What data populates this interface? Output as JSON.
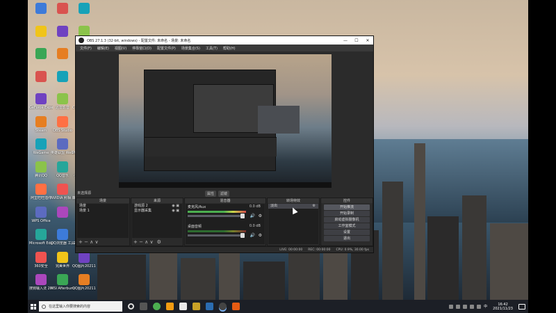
{
  "desktop": {
    "icons_col1": [
      "",
      "",
      "",
      "",
      "GeForce Experience",
      "Steam",
      "WeGame",
      "腾讯QQ",
      "阿里旺旺插件",
      "WPS Office",
      "Microsoft Edge",
      "360安全",
      "搜狗输入法 2021..."
    ],
    "icons_col2": [
      "",
      "",
      "",
      "",
      "迅雷影音",
      "OBS Studio",
      "英雄联盟 WeGame",
      "QQ音乐",
      "NVIDIA 照相 机 - 画面",
      "",
      "QQ浏览器 工具",
      "完美世界",
      "MSI Afterburner"
    ],
    "icons_col3": [
      "",
      "",
      "",
      "",
      "Counter-Strike Global Off...",
      "",
      "PUBG Lite Game",
      "小黑盒加速器",
      "新建 RTF 文档",
      "",
      "20210927...",
      "QQ图片20211110...",
      "QQ图片20211120..."
    ]
  },
  "obs": {
    "title": "OBS 27.1.3 (32-bit, windows) - 配置文件: 未命名 - 场景: 未命名",
    "menu": [
      "文件(F)",
      "编辑(E)",
      "视图(V)",
      "停靠窗口(D)",
      "配置文件(P)",
      "场景集合(S)",
      "工具(T)",
      "帮助(H)"
    ],
    "window_buttons": [
      "—",
      "☐",
      "✕"
    ],
    "source_label": "未选择源",
    "transition_buttons": [
      "属性",
      "滤镜"
    ],
    "scenes": {
      "header": "场景",
      "items": [
        "场景",
        "场景 1"
      ]
    },
    "sources": {
      "header": "来源",
      "items": [
        "游戏源 2",
        "显示器采集"
      ]
    },
    "mixer": {
      "header": "混音器",
      "channels": [
        {
          "name": "麦克风/Aux",
          "db": "0.0 dB"
        },
        {
          "name": "桌面音频",
          "db": "0.0 dB"
        }
      ]
    },
    "transitions": {
      "header": "转场特效",
      "type": "淡出"
    },
    "controls": {
      "header": "控件",
      "buttons": [
        "开始推流",
        "开始录制",
        "启动虚拟摄像机",
        "工作室模式",
        "设置",
        "退出"
      ]
    },
    "status": {
      "live": "LIVE: 00:00:00",
      "rec": "REC: 00:00:00",
      "cpu": "CPU: 0.9%, 30.00 fps"
    },
    "dock_footer": "+ − ∧ ∨"
  },
  "taskbar": {
    "search_placeholder": "在这里输入你要搜索的内容",
    "time": "16:42",
    "date": "2021/11/23",
    "tray_lang": "中"
  }
}
